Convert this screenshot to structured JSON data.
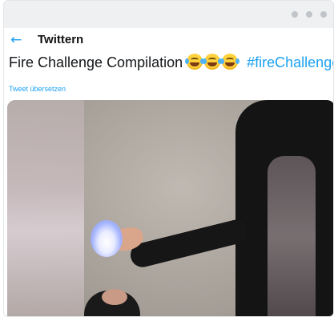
{
  "header": {
    "title": "Twittern",
    "back_icon": "←"
  },
  "tweet": {
    "text": "Fire Challenge Compilation",
    "emoji_count": 3,
    "emoji_name": "face-with-tears-of-joy",
    "hashtag": "#fireChallenge",
    "translate_label": "Tweet übersetzen"
  },
  "colors": {
    "accent": "#1da1f2",
    "text": "#14171a",
    "titlebar": "#eef0f2"
  }
}
